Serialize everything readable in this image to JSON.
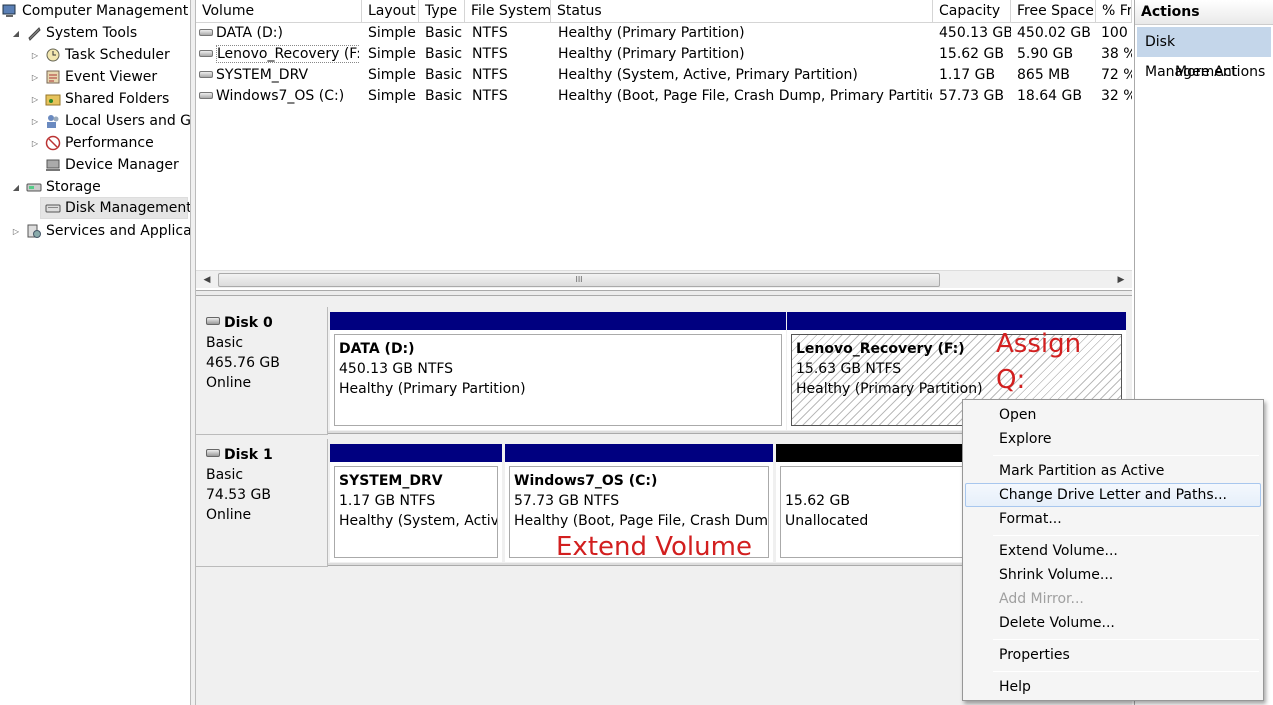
{
  "tree": {
    "items": [
      {
        "label": "Computer Management",
        "icon": "computer-management-icon",
        "expander": ""
      },
      {
        "label": "System Tools",
        "icon": "tools-icon",
        "expander": "◢"
      },
      {
        "label": "Task Scheduler",
        "icon": "clock-icon",
        "expander": "▷"
      },
      {
        "label": "Event Viewer",
        "icon": "event-viewer-icon",
        "expander": "▷"
      },
      {
        "label": "Shared Folders",
        "icon": "shared-folder-icon",
        "expander": "▷"
      },
      {
        "label": "Local Users and Gro",
        "icon": "users-icon",
        "expander": "▷"
      },
      {
        "label": "Performance",
        "icon": "performance-icon",
        "expander": "▷"
      },
      {
        "label": "Device Manager",
        "icon": "device-manager-icon",
        "expander": ""
      },
      {
        "label": "Storage",
        "icon": "storage-icon",
        "expander": "◢"
      },
      {
        "label": "Disk Management",
        "icon": "disk-management-icon",
        "expander": ""
      },
      {
        "label": "Services and Applicat",
        "icon": "services-icon",
        "expander": "▷"
      }
    ]
  },
  "volumes": {
    "columns": [
      "Volume",
      "Layout",
      "Type",
      "File System",
      "Status",
      "Capacity",
      "Free Space",
      "% Fr"
    ],
    "rows": [
      [
        "DATA (D:)",
        "Simple",
        "Basic",
        "NTFS",
        "Healthy (Primary Partition)",
        "450.13 GB",
        "450.02 GB",
        "100"
      ],
      [
        "Lenovo_Recovery (F:)",
        "Simple",
        "Basic",
        "NTFS",
        "Healthy (Primary Partition)",
        "15.62 GB",
        "5.90 GB",
        "38 %"
      ],
      [
        "SYSTEM_DRV",
        "Simple",
        "Basic",
        "NTFS",
        "Healthy (System, Active, Primary Partition)",
        "1.17 GB",
        "865 MB",
        "72 %"
      ],
      [
        "Windows7_OS (C:)",
        "Simple",
        "Basic",
        "NTFS",
        "Healthy (Boot, Page File, Crash Dump, Primary Partition)",
        "57.73 GB",
        "18.64 GB",
        "32 %"
      ]
    ],
    "scroll_grip": "III"
  },
  "disks": [
    {
      "name": "Disk 0",
      "type": "Basic",
      "size": "465.76 GB",
      "state": "Online",
      "partitions": [
        {
          "name": "DATA  (D:)",
          "size": "450.13 GB NTFS",
          "status": "Healthy (Primary Partition)"
        },
        {
          "name": "Lenovo_Recovery  (F:)",
          "size": "15.63 GB NTFS",
          "status": "Healthy (Primary Partition)"
        }
      ]
    },
    {
      "name": "Disk 1",
      "type": "Basic",
      "size": "74.53 GB",
      "state": "Online",
      "partitions": [
        {
          "name": "SYSTEM_DRV",
          "size": "1.17 GB NTFS",
          "status": "Healthy (System, Active,"
        },
        {
          "name": "Windows7_OS  (C:)",
          "size": "57.73 GB NTFS",
          "status": "Healthy (Boot, Page File, Crash Dump,"
        },
        {
          "name": "",
          "size": "15.62 GB",
          "status": "Unallocated"
        }
      ]
    }
  ],
  "annotations": {
    "assign_line1": "Assign",
    "assign_line2": "Q:",
    "extend": "Extend Volume"
  },
  "actions": {
    "title": "Actions",
    "section": "Disk Management",
    "more": "More Actions"
  },
  "context_menu": {
    "items": [
      "Open",
      "Explore",
      "Mark Partition as Active",
      "Change Drive Letter and Paths...",
      "Format...",
      "Extend Volume...",
      "Shrink Volume...",
      "Add Mirror...",
      "Delete Volume...",
      "Properties",
      "Help"
    ],
    "highlighted": "Change Drive Letter and Paths...",
    "disabled": [
      "Add Mirror..."
    ]
  },
  "colors": {
    "partition_bar": "#000080",
    "unallocated_bar": "#000000",
    "annotation": "#d21f1f",
    "actions_section": "#c4d6ea"
  }
}
